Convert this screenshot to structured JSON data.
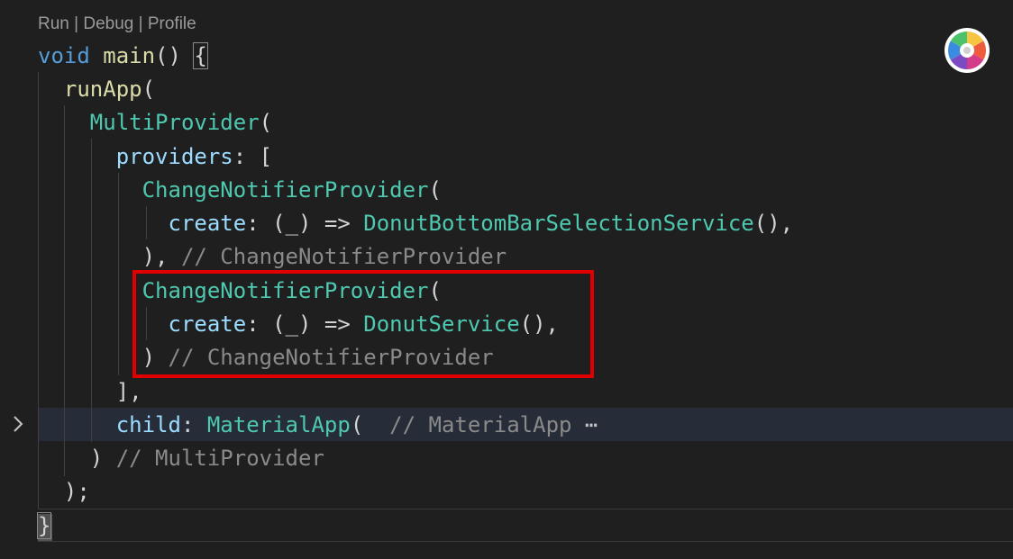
{
  "codelens": {
    "run": "Run",
    "debug": "Debug",
    "profile": "Profile",
    "separator": "|"
  },
  "code": {
    "l1": {
      "kw": "void",
      "fn": "main",
      "paren": "()",
      "brace": "{"
    },
    "l2": {
      "fn": "runApp",
      "paren": "("
    },
    "l3": {
      "cls": "MultiProvider",
      "paren": "("
    },
    "l4": {
      "prop": "providers",
      "rest": ": ["
    },
    "l5": {
      "cls": "ChangeNotifierProvider",
      "paren": "("
    },
    "l6": {
      "prop": "create",
      "mid": ": (",
      "us": "_",
      "arrow": ") => ",
      "cls": "DonutBottomBarSelectionService",
      "end": "(),"
    },
    "l7": {
      "pun": "),",
      "cmt": "// ChangeNotifierProvider"
    },
    "l8": {
      "cls": "ChangeNotifierProvider",
      "paren": "("
    },
    "l9": {
      "prop": "create",
      "mid": ": (",
      "us": "_",
      "arrow": ") => ",
      "cls": "DonutService",
      "end": "(),"
    },
    "l10": {
      "pun": ")",
      "cmt": "// ChangeNotifierProvider"
    },
    "l11": {
      "pun": "],"
    },
    "l12": {
      "prop": "child",
      "colon": ": ",
      "cls": "MaterialApp",
      "paren": "(",
      "cmt": "// MaterialApp",
      "dots": "⋯"
    },
    "l13": {
      "pun": ")",
      "cmt": "// MultiProvider"
    },
    "l14": {
      "pun": ");"
    },
    "l15": {
      "pun": "}"
    }
  },
  "icons": {
    "fold": "chevron-right-icon",
    "extension": "color-wheel-icon"
  },
  "colors": {
    "keyword": "#569cd6",
    "function": "#dcdcaa",
    "class": "#4ec9b0",
    "property": "#9cdcfe",
    "comment": "#8a8a8a",
    "highlight_border": "#e00000",
    "background": "#1f1f1f"
  }
}
